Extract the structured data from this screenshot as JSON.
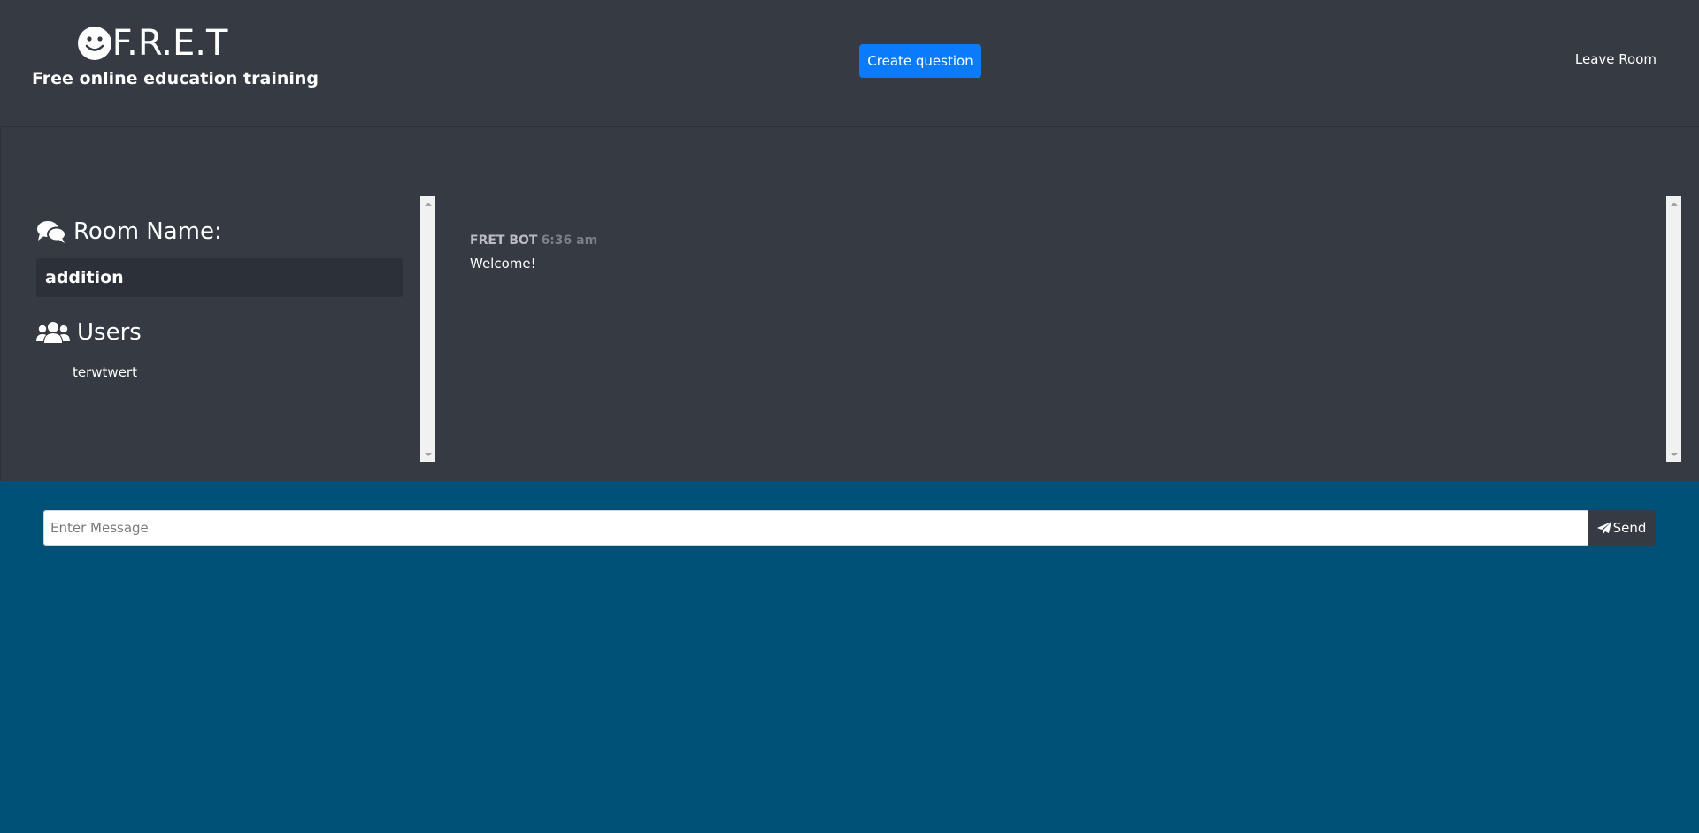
{
  "header": {
    "brand_name": "F.R.E.T",
    "tagline": "Free online education training",
    "create_question_label": "Create question",
    "leave_room_label": "Leave Room"
  },
  "sidebar": {
    "room_heading": "Room Name:",
    "room_name": "addition",
    "users_heading": "Users",
    "users": [
      "terwtwert"
    ]
  },
  "chat": {
    "messages": [
      {
        "author": "FRET BOT",
        "time": "6:36 am",
        "text": "Welcome!"
      }
    ]
  },
  "composer": {
    "placeholder": "Enter Message",
    "value": "",
    "send_label": "Send"
  },
  "colors": {
    "header_bg": "#353a43",
    "page_bg": "#005178",
    "accent": "#0b7bfe"
  }
}
